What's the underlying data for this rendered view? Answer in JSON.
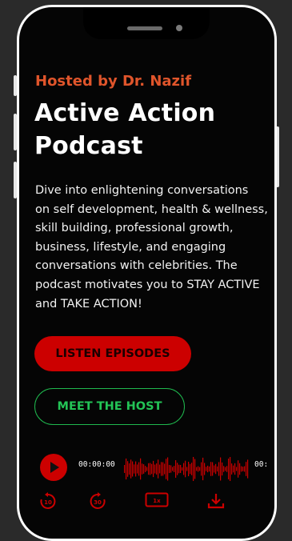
{
  "header": {
    "host_line": "Hosted by Dr. Nazif",
    "title_line1": "Active Action",
    "title_line2": "Podcast"
  },
  "description": [
    "Dive into enlightening conversations",
    "on self development, health & wellness,",
    "skill building, professional growth,",
    "business, lifestyle, and engaging",
    "conversations with celebrities. The",
    "podcast motivates you to STAY ACTIVE",
    "and TAKE ACTION!"
  ],
  "buttons": {
    "listen_label": "LISTEN EPISODES",
    "meet_label": "MEET THE HOST"
  },
  "player": {
    "current_time": "00:00:00",
    "duration_time": "00:",
    "skip_back": "10",
    "skip_forward": "30",
    "speed": "1x",
    "icons": [
      "play-icon",
      "skip-back-10-icon",
      "skip-forward-30-icon",
      "speed-icon",
      "download-icon"
    ]
  },
  "colors": {
    "accent_red": "#cc0000",
    "host_orange": "#e0552b",
    "host_green": "#1fb84e",
    "background": "#050505"
  }
}
